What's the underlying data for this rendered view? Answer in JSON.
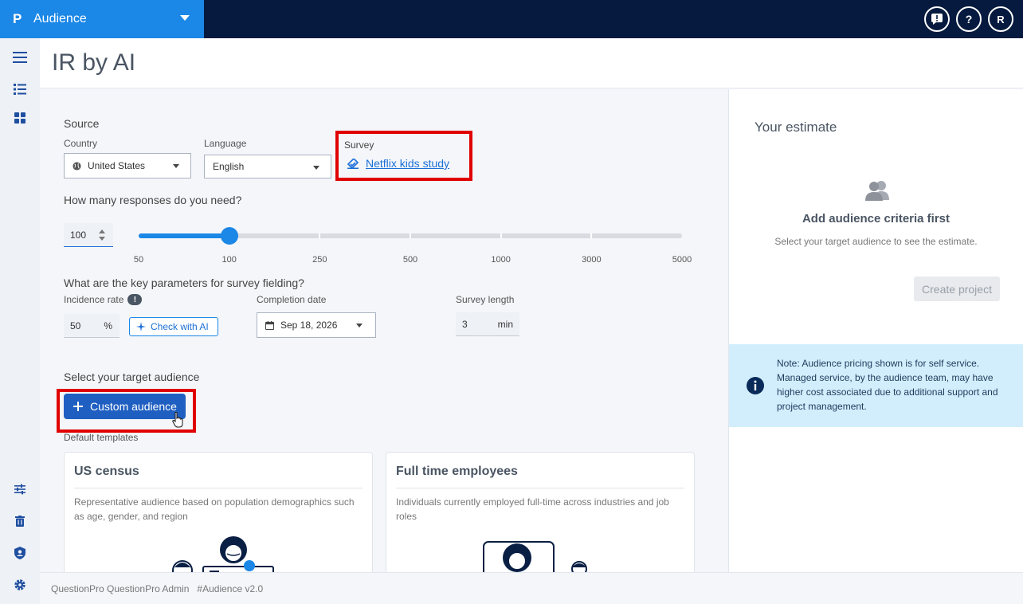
{
  "app": {
    "logo": "P",
    "name": "Audience"
  },
  "topbar": {
    "user_initial": "R",
    "help": "?",
    "feedback": "!"
  },
  "page": {
    "title": "IR by AI"
  },
  "source": {
    "heading": "Source",
    "country_label": "Country",
    "country_value": "United States",
    "language_label": "Language",
    "language_value": "English",
    "survey_label": "Survey",
    "survey_link": "Netflix kids study"
  },
  "responses": {
    "question": "How many responses do you need?",
    "value": "100",
    "ticks": [
      "50",
      "100",
      "250",
      "500",
      "1000",
      "3000",
      "5000"
    ],
    "selected_index": 1
  },
  "params": {
    "question": "What are the key parameters for survey fielding?",
    "incidence_label": "Incidence rate",
    "incidence_value": "50",
    "incidence_unit": "%",
    "check_ai": "Check with AI",
    "completion_label": "Completion date",
    "completion_value": "Sep 18, 2026",
    "length_label": "Survey length",
    "length_value": "3",
    "length_unit": "min"
  },
  "audience": {
    "heading": "Select your target audience",
    "custom_button": "Custom audience",
    "templates_label": "Default templates",
    "cards": [
      {
        "title": "US census",
        "desc": "Representative audience based on population demographics such as age, gender, and region"
      },
      {
        "title": "Full time employees",
        "desc": "Individuals currently employed full-time across industries and job roles"
      }
    ]
  },
  "estimate": {
    "heading": "Your estimate",
    "empty_title": "Add audience criteria first",
    "empty_desc": "Select your target audience to see the estimate.",
    "create_button": "Create project",
    "note": "Note: Audience pricing shown is for self service. Managed service, by the audience team, may have higher cost associated due to additional support and project management."
  },
  "footer": {
    "text": "QuestionPro QuestionPro Admin   #Audience v2.0"
  },
  "colors": {
    "brand": "#1b87e6",
    "nav": "#061a3f",
    "primary": "#1f5fc1",
    "highlight": "#e00000",
    "note_bg": "#d2eefc"
  }
}
